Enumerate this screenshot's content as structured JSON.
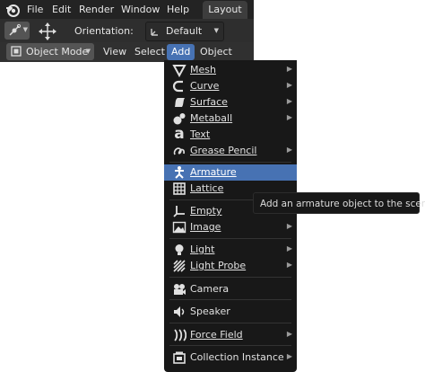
{
  "topbar": {
    "menus": [
      "File",
      "Edit",
      "Render",
      "Window",
      "Help"
    ],
    "workspace_tab": "Layout"
  },
  "toolbar": {
    "orientation_label": "Orientation:",
    "orientation_value": "Default"
  },
  "header": {
    "mode": "Object Mode",
    "menus": [
      "View",
      "Select",
      "Add",
      "Object"
    ],
    "active_menu": "Add"
  },
  "add_menu": {
    "items": [
      {
        "label": "Mesh",
        "icon": "mesh-icon",
        "submenu": true
      },
      {
        "label": "Curve",
        "icon": "curve-icon",
        "submenu": true
      },
      {
        "label": "Surface",
        "icon": "surface-icon",
        "submenu": true
      },
      {
        "label": "Metaball",
        "icon": "metaball-icon",
        "submenu": true
      },
      {
        "label": "Text",
        "icon": "text-icon",
        "submenu": false
      },
      {
        "label": "Grease Pencil",
        "icon": "grease-pencil-icon",
        "submenu": true
      },
      {
        "label": "Armature",
        "icon": "armature-icon",
        "submenu": false,
        "highlighted": true
      },
      {
        "label": "Lattice",
        "icon": "lattice-icon",
        "submenu": false
      },
      {
        "label": "Empty",
        "icon": "empty-icon",
        "submenu": true
      },
      {
        "label": "Image",
        "icon": "image-icon",
        "submenu": true
      },
      {
        "label": "Light",
        "icon": "light-icon",
        "submenu": true
      },
      {
        "label": "Light Probe",
        "icon": "light-probe-icon",
        "submenu": true
      },
      {
        "label": "Camera",
        "icon": "camera-icon",
        "submenu": false
      },
      {
        "label": "Speaker",
        "icon": "speaker-icon",
        "submenu": false
      },
      {
        "label": "Force Field",
        "icon": "force-field-icon",
        "submenu": true
      },
      {
        "label": "Collection Instance",
        "icon": "collection-instance-icon",
        "submenu": true
      }
    ]
  },
  "tooltip": {
    "text": "Add an armature object to the scene."
  },
  "colors": {
    "highlight": "#4772b3",
    "menu_bg": "#181818",
    "header_bg": "#232323"
  }
}
